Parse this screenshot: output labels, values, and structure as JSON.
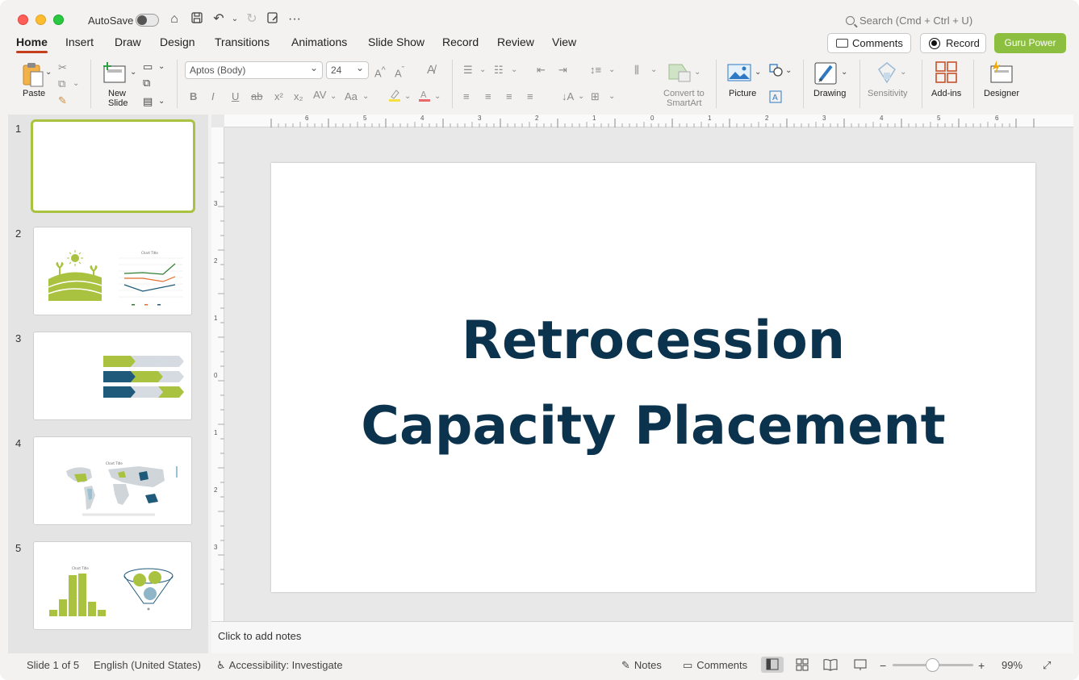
{
  "window": {
    "autosave_label": "AutoSave",
    "search_placeholder": "Search (Cmd + Ctrl + U)"
  },
  "tabs": [
    "Home",
    "Insert",
    "Draw",
    "Design",
    "Transitions",
    "Animations",
    "Slide Show",
    "Record",
    "Review",
    "View"
  ],
  "header_buttons": {
    "comments": "Comments",
    "record": "Record",
    "guru": "Guru Power"
  },
  "ribbon": {
    "paste": "Paste",
    "new_slide_line1": "New",
    "new_slide_line2": "Slide",
    "font_name": "Aptos (Body)",
    "font_size": "24",
    "convert_line1": "Convert to",
    "convert_line2": "SmartArt",
    "picture": "Picture",
    "drawing": "Drawing",
    "sensitivity": "Sensitivity",
    "addins": "Add-ins",
    "designer": "Designer"
  },
  "slides": [
    {
      "number": "1"
    },
    {
      "number": "2",
      "chart_title": "Chart Title"
    },
    {
      "number": "3"
    },
    {
      "number": "4",
      "chart_title": "Chart Title"
    },
    {
      "number": "5",
      "chart_title": "Chart Title"
    }
  ],
  "main_slide": {
    "title_line1": "Retrocession",
    "title_line2": "Capacity Placement",
    "title_color": "#0c334d"
  },
  "ruler": {
    "horizontal": [
      "6",
      "5",
      "4",
      "3",
      "2",
      "1",
      "0",
      "1",
      "2",
      "3",
      "4",
      "5",
      "6"
    ],
    "vertical": [
      "3",
      "2",
      "1",
      "0",
      "1",
      "2",
      "3"
    ]
  },
  "notes_placeholder": "Click to add notes",
  "status": {
    "slide_info": "Slide 1 of 5",
    "language": "English (United States)",
    "accessibility": "Accessibility: Investigate",
    "notes": "Notes",
    "comments": "Comments",
    "zoom": "99%"
  },
  "colors": {
    "accent_green": "#a9c23f",
    "tab_underline": "#c43e1c",
    "guru_button": "#8cbf3f"
  }
}
